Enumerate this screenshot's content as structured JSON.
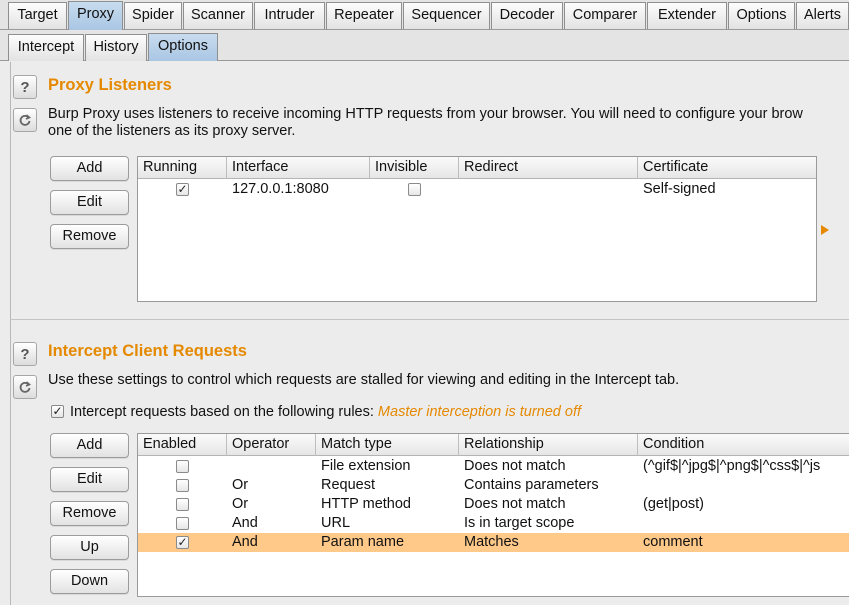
{
  "main_tabs": [
    {
      "label": "Target",
      "active": false
    },
    {
      "label": "Proxy",
      "active": true
    },
    {
      "label": "Spider",
      "active": false
    },
    {
      "label": "Scanner",
      "active": false
    },
    {
      "label": "Intruder",
      "active": false
    },
    {
      "label": "Repeater",
      "active": false
    },
    {
      "label": "Sequencer",
      "active": false
    },
    {
      "label": "Decoder",
      "active": false
    },
    {
      "label": "Comparer",
      "active": false
    },
    {
      "label": "Extender",
      "active": false
    },
    {
      "label": "Options",
      "active": false
    },
    {
      "label": "Alerts",
      "active": false
    }
  ],
  "sub_tabs": [
    {
      "label": "Intercept",
      "active": false
    },
    {
      "label": "History",
      "active": false
    },
    {
      "label": "Options",
      "active": true
    }
  ],
  "icons": {
    "help": "question-mark",
    "restore": "refresh-arrow",
    "expand": "triangle-right"
  },
  "colors": {
    "accent": "#e58900",
    "selected_row": "#ffc98a",
    "active_tab": "#b4cfe9"
  },
  "proxy_listeners": {
    "title": "Proxy Listeners",
    "description_line1": "Burp Proxy uses listeners to receive incoming HTTP requests from your browser. You will need to configure your brow",
    "description_line2": "one of the listeners as its proxy server.",
    "buttons": {
      "add": "Add",
      "edit": "Edit",
      "remove": "Remove"
    },
    "columns": [
      "Running",
      "Interface",
      "Invisible",
      "Redirect",
      "Certificate"
    ],
    "rows": [
      {
        "running": true,
        "interface": "127.0.0.1:8080",
        "invisible": false,
        "redirect": "",
        "certificate": "Self-signed"
      }
    ]
  },
  "intercept_client": {
    "title": "Intercept Client Requests",
    "description": "Use these settings to control which requests are stalled for viewing and editing in the Intercept tab.",
    "intercept_checkbox_label": "Intercept requests based on the following rules:",
    "intercept_checkbox_checked": true,
    "master_status": "Master interception is turned off",
    "buttons": {
      "add": "Add",
      "edit": "Edit",
      "remove": "Remove",
      "up": "Up",
      "down": "Down"
    },
    "columns": [
      "Enabled",
      "Operator",
      "Match type",
      "Relationship",
      "Condition"
    ],
    "rows": [
      {
        "enabled": false,
        "operator": "",
        "match_type": "File extension",
        "relationship": "Does not match",
        "condition": "(^gif$|^jpg$|^png$|^css$|^js",
        "selected": false
      },
      {
        "enabled": false,
        "operator": "Or",
        "match_type": "Request",
        "relationship": "Contains parameters",
        "condition": "",
        "selected": false
      },
      {
        "enabled": false,
        "operator": "Or",
        "match_type": "HTTP method",
        "relationship": "Does not match",
        "condition": "(get|post)",
        "selected": false
      },
      {
        "enabled": false,
        "operator": "And",
        "match_type": "URL",
        "relationship": "Is in target scope",
        "condition": "",
        "selected": false
      },
      {
        "enabled": true,
        "operator": "And",
        "match_type": "Param name",
        "relationship": "Matches",
        "condition": "comment",
        "selected": true
      }
    ]
  }
}
